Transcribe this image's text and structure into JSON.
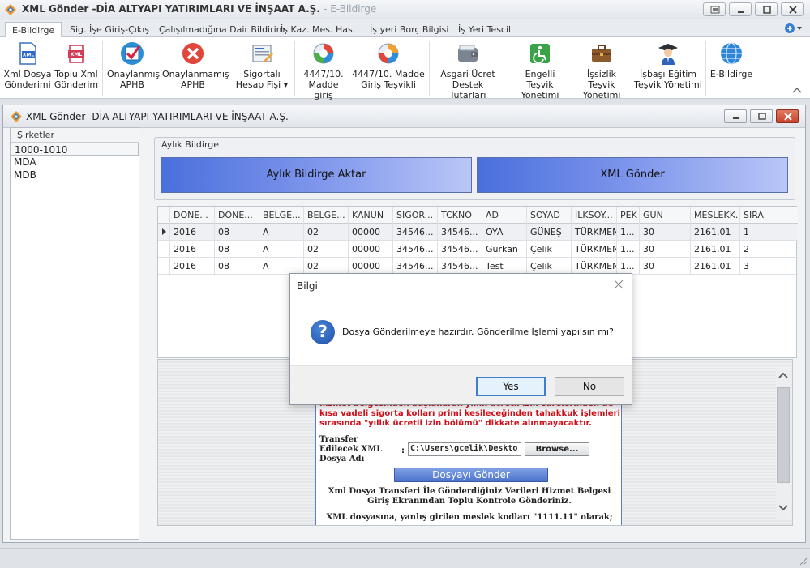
{
  "app": {
    "title": "XML Gönder -DİA ALTYAPI YATIRIMLARI VE İNŞAAT A.Ş.",
    "title_suffix": "- E-Bildirge"
  },
  "ribbon_tabs": [
    "E-Bildirge",
    "Sig. İşe Giriş-Çıkış",
    "Çalışılmadığına Dair Bildirim",
    "İş Kaz. Mes. Has.",
    "İş yeri Borç Bilgisi",
    "İş Yeri Tescil"
  ],
  "ribbon_buttons": [
    {
      "line1": "Xml Dosya",
      "line2": "Gönderimi",
      "icon": "xml-file-icon"
    },
    {
      "line1": "Toplu Xml",
      "line2": "Gönderim",
      "icon": "bulk-xml-icon"
    },
    {
      "line1": "Onaylanmış",
      "line2": "APHB",
      "icon": "approved-check-icon"
    },
    {
      "line1": "Onaylanmamış",
      "line2": "APHB",
      "icon": "unapproved-x-icon"
    },
    {
      "line1": "Sigortalı",
      "line2": "Hesap Fişi ▾",
      "icon": "insured-account-icon"
    },
    {
      "line1": "4447/10.",
      "line2": "Madde giriş",
      "icon": "article-entry-icon"
    },
    {
      "line1": "4447/10. Madde",
      "line2": "Giriş Teşvikli",
      "icon": "article-incentive-icon"
    },
    {
      "line1": "Asgari Ücret",
      "line2": "Destek Tutarları",
      "icon": "wallet-icon"
    },
    {
      "line1": "Engelli Teşvik",
      "line2": "Yönetimi",
      "icon": "wheelchair-icon"
    },
    {
      "line1": "İşsizlik Teşvik",
      "line2": "Yönetimi",
      "icon": "briefcase-icon"
    },
    {
      "line1": "İşbaşı Eğitim",
      "line2": "Teşvik Yönetimi",
      "icon": "graduate-icon"
    },
    {
      "line1": "E-Bildirge",
      "line2": "",
      "icon": "globe-icon"
    }
  ],
  "child_window": {
    "title": "XML Gönder -DİA ALTYAPI YATIRIMLARI VE İNŞAAT A.Ş."
  },
  "companies": {
    "header": "Şirketler",
    "items": [
      "1000-1010",
      "MDA",
      "MDB"
    ]
  },
  "monthly": {
    "group_title": "Aylık Bildirge",
    "transfer_button": "Aylık Bildirge Aktar",
    "xml_button": "XML Gönder"
  },
  "grid": {
    "columns": [
      "DONE...",
      "DONE...",
      "BELGE...",
      "BELGE...",
      "KANUN",
      "SIGOR...",
      "TCKNO",
      "AD",
      "SOYAD",
      "ILKSOY...",
      "PEK",
      "GUN",
      "MESLEKK...",
      "SIRA"
    ],
    "rows": [
      [
        "2016",
        "08",
        "A",
        "02",
        "00000",
        "34546...",
        "34546...",
        "OYA",
        "GÜNEŞ",
        "TÜRKMEN",
        "1...",
        "30",
        "2161.01",
        "1"
      ],
      [
        "2016",
        "08",
        "A",
        "02",
        "00000",
        "34546...",
        "34546...",
        "Gürkan",
        "Çelik",
        "TÜRKMEN",
        "1...",
        "30",
        "2161.01",
        "2"
      ],
      [
        "2016",
        "08",
        "A",
        "02",
        "00000",
        "34546...",
        "34546...",
        "Test",
        "Çelik",
        "TÜRKMEN",
        "1...",
        "30",
        "2161.01",
        "3"
      ]
    ]
  },
  "web": {
    "red_line1": "hizmet belgesinden başlanarak yıllık ücretli izin sürelerinden de",
    "red_line2": "kısa vadeli sigorta kolları primi kesileceğinden tahakkuk işlemleri",
    "red_line3": "sırasında \"yıllık ücretli izin bölümü\" dikkate alınmayacaktır.",
    "transfer_label1": "Transfer",
    "transfer_label2": "Edilecek XML",
    "transfer_label3": "Dosya Adı",
    "colon": ":",
    "path_value": "C:\\Users\\gcelik\\Deskto",
    "browse_label": "Browse...",
    "send_label": "Dosyayı Gönder",
    "info1_line1": "Xml Dosya Transferi İle Gönderdiğiniz Verileri Hizmet Belgesi",
    "info1_line2": "Giriş Ekranından Toplu Kontrole Gönderiniz.",
    "info2_line1": "XML dosyasına, yanlış girilen meslek kodları \"1111.11\" olarak;"
  },
  "dialog": {
    "title": "Bilgi",
    "message": "Dosya Gönderilmeye hazırdır. Gönderilme İşlemi yapılsın mı?",
    "yes": "Yes",
    "no": "No"
  }
}
